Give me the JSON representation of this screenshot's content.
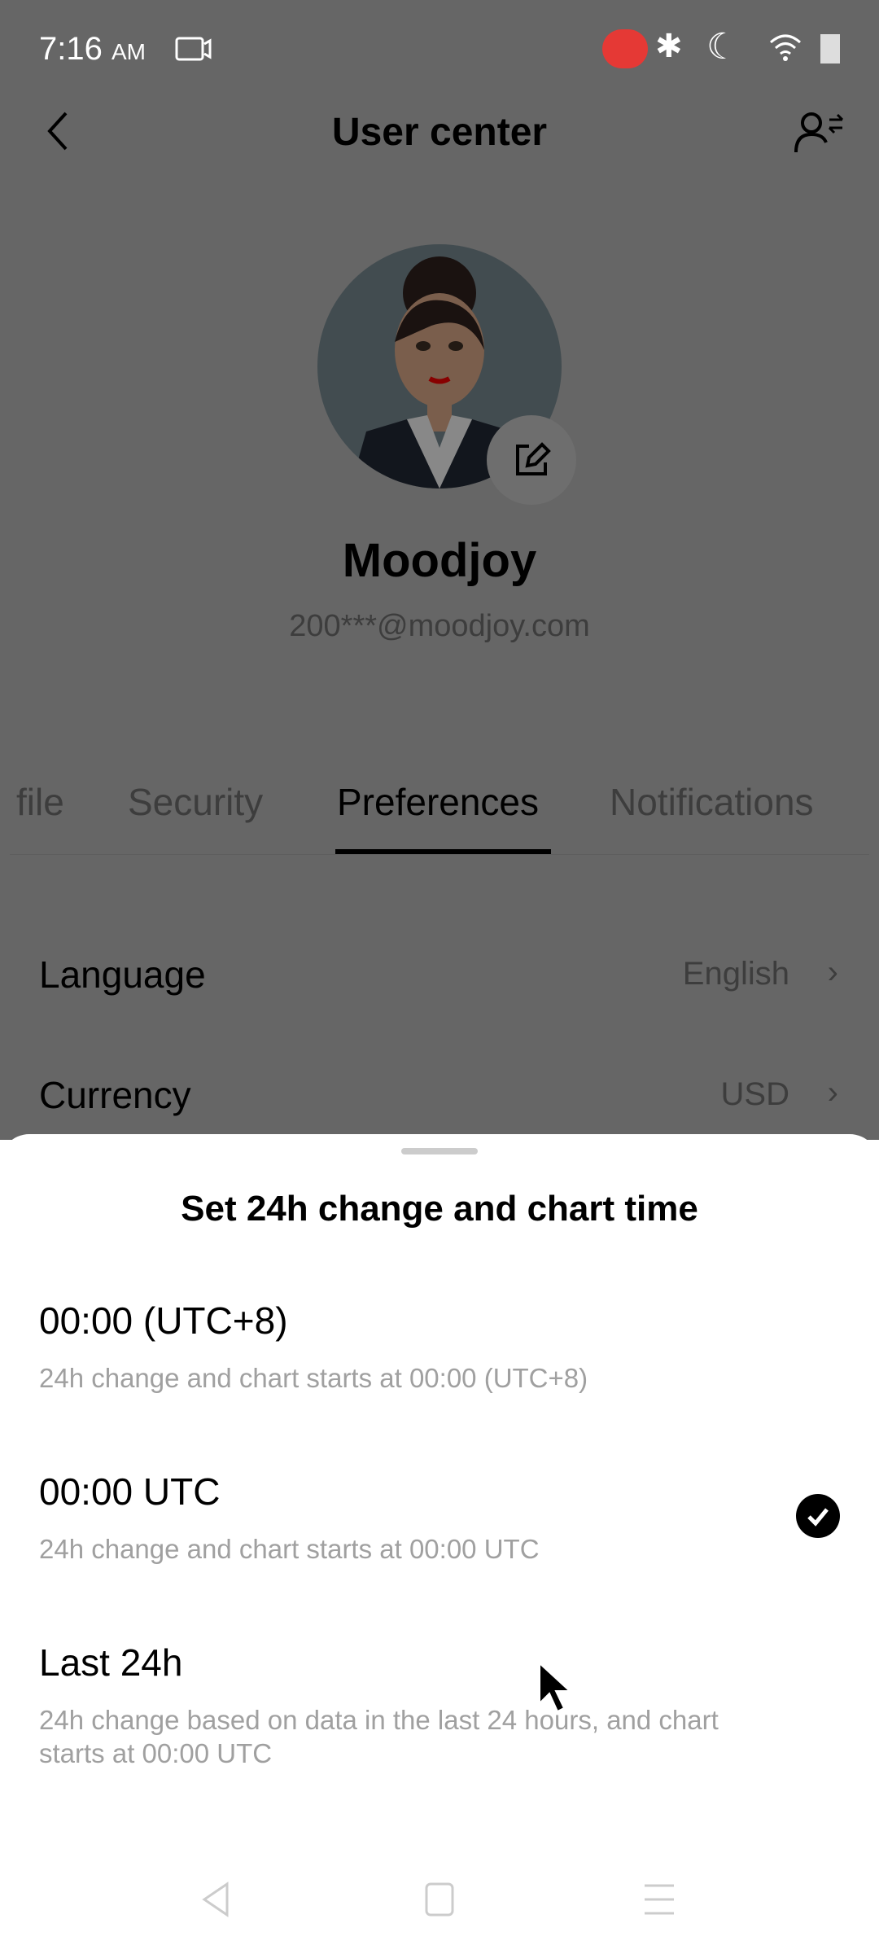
{
  "status_bar": {
    "time": "7:16",
    "ampm": "AM",
    "icons": [
      "screen-record-icon",
      "recording-indicator-icon",
      "bluetooth-icon",
      "do-not-disturb-moon-icon",
      "wifi-icon",
      "battery-icon"
    ],
    "record_color": "#e53935"
  },
  "header": {
    "title": "User center",
    "back_icon": "chevron-left-icon",
    "switch_account_icon": "user-switch-icon"
  },
  "profile": {
    "name": "Moodjoy",
    "email": "200***@moodjoy.com"
  },
  "tabs": [
    {
      "label": "file",
      "active": false
    },
    {
      "label": "Security",
      "active": false
    },
    {
      "label": "Preferences",
      "active": true
    },
    {
      "label": "Notifications",
      "active": false
    }
  ],
  "settings": [
    {
      "label": "Language",
      "value": "English"
    },
    {
      "label": "Currency",
      "value": "USD"
    }
  ],
  "sheet": {
    "title": "Set 24h change and chart time",
    "options": [
      {
        "title": "00:00 (UTC+8)",
        "subtitle": "24h change and chart starts at 00:00 (UTC+8)",
        "selected": false
      },
      {
        "title": "00:00 UTC",
        "subtitle": "24h change and chart starts at 00:00 UTC",
        "selected": true
      },
      {
        "title": "Last 24h",
        "subtitle": "24h change based on data in the last 24 hours, and chart starts at 00:00 UTC",
        "selected": false
      }
    ]
  },
  "nav_bar": {
    "icons": [
      "back-triangle-icon",
      "home-square-icon",
      "menu-lines-icon"
    ]
  }
}
